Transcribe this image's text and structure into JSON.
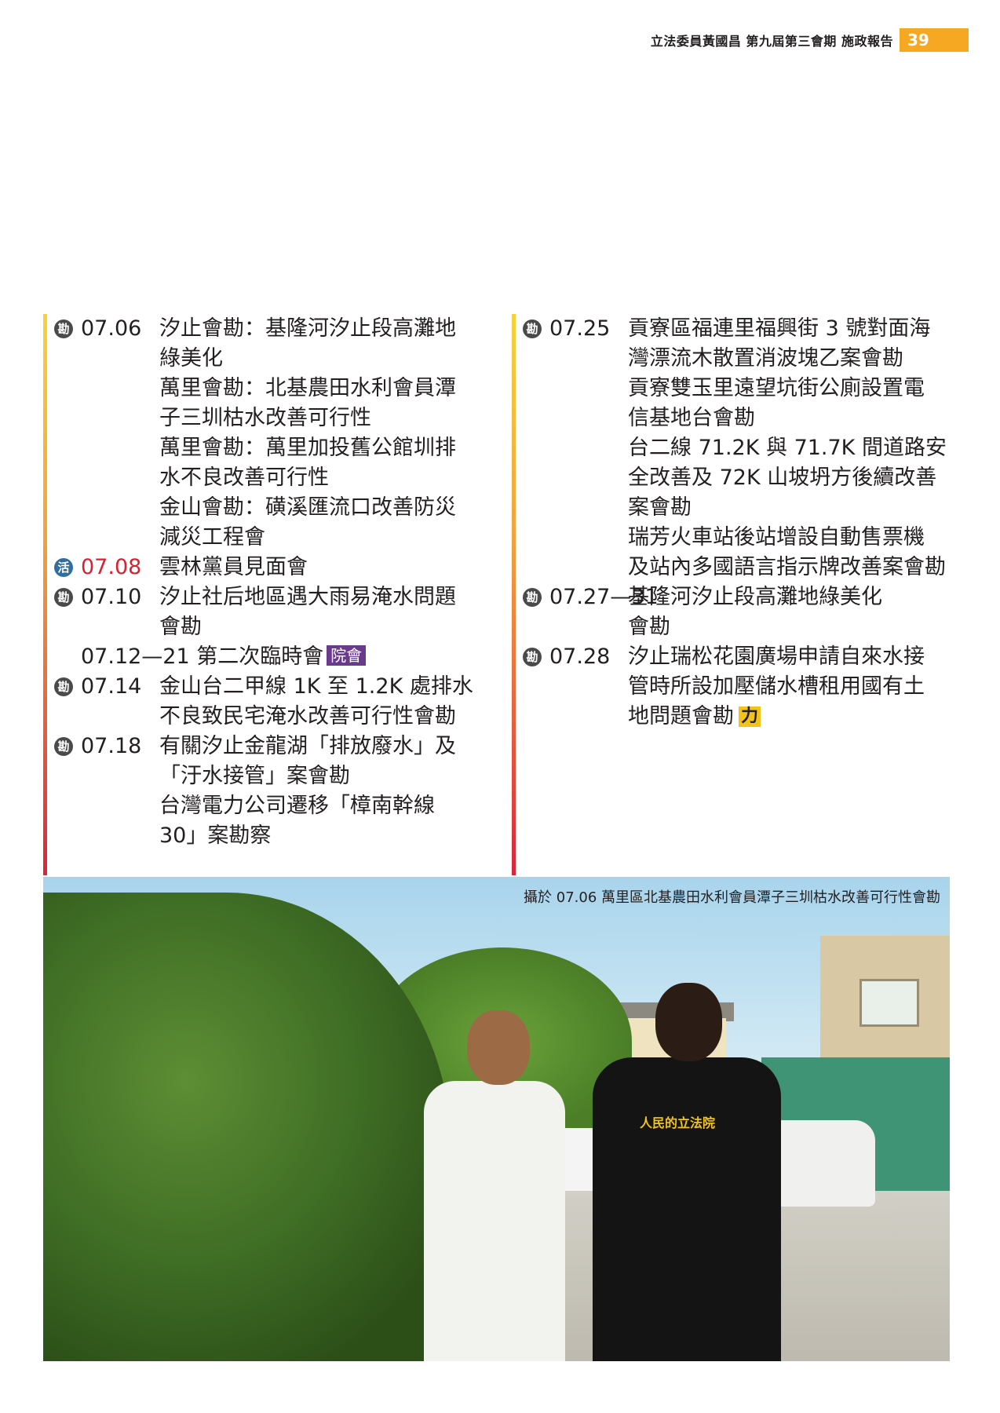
{
  "header": {
    "title": "立法委員黃國昌 第九屆第三會期 施政報告",
    "page": "39"
  },
  "badges": {
    "survey": "勘",
    "event": "活"
  },
  "left_column": [
    {
      "type": "survey",
      "date": "07.06",
      "lines": [
        "汐止會勘：基隆河汐止段高灘地",
        "綠美化",
        "萬里會勘：北基農田水利會員潭",
        "子三圳枯水改善可行性",
        "萬里會勘：萬里加投舊公館圳排",
        "水不良改善可行性",
        "金山會勘：磺溪匯流口改善防災",
        "減災工程會"
      ]
    },
    {
      "type": "event",
      "date": "07.08",
      "lines": [
        "雲林黨員見面會"
      ]
    },
    {
      "type": "survey",
      "date": "07.10",
      "lines": [
        "汐止社后地區遇大雨易淹水問題",
        "會勘"
      ]
    },
    {
      "type": "none",
      "text": "07.12—21 第二次臨時會",
      "tag": "院會"
    },
    {
      "type": "survey",
      "date": "07.14",
      "lines": [
        "金山台二甲線 1K 至 1.2K 處排水",
        "不良致民宅淹水改善可行性會勘"
      ]
    },
    {
      "type": "survey",
      "date": "07.18",
      "lines": [
        "有關汐止金龍湖「排放廢水」及",
        "「汙水接管」案會勘",
        "台灣電力公司遷移「樟南幹線",
        "30」案勘察"
      ]
    }
  ],
  "right_column": [
    {
      "type": "survey",
      "date": "07.25",
      "lines": [
        "貢寮區福連里福興街 3 號對面海",
        "灣漂流木散置消波塊乙案會勘",
        "貢寮雙玉里遠望坑街公廁設置電",
        "信基地台會勘",
        "台二線 71.2K 與 71.7K 間道路安",
        "全改善及 72K 山坡坍方後續改善",
        "案會勘",
        "瑞芳火車站後站增設自動售票機",
        "及站內多國語言指示牌改善案會勘"
      ]
    },
    {
      "type": "survey",
      "date": "07.27—31",
      "lines": [
        "基隆河汐止段高灘地綠美化",
        "會勘"
      ]
    },
    {
      "type": "survey",
      "date": "07.28",
      "lines": [
        "汐止瑞松花園廣場申請自來水接",
        "管時所設加壓儲水槽租用國有土",
        "地問題會勘"
      ],
      "logo": "力"
    }
  ],
  "photo": {
    "caption": "攝於 07.06 萬里區北基農田水利會員潭子三圳枯水改善可行性會勘",
    "shirt_text": "人民的立法院"
  },
  "colors": {
    "accent": "#f7a823",
    "red": "#d7222f",
    "tag": "#6a3b8c",
    "badge": "#4a4a4a"
  }
}
